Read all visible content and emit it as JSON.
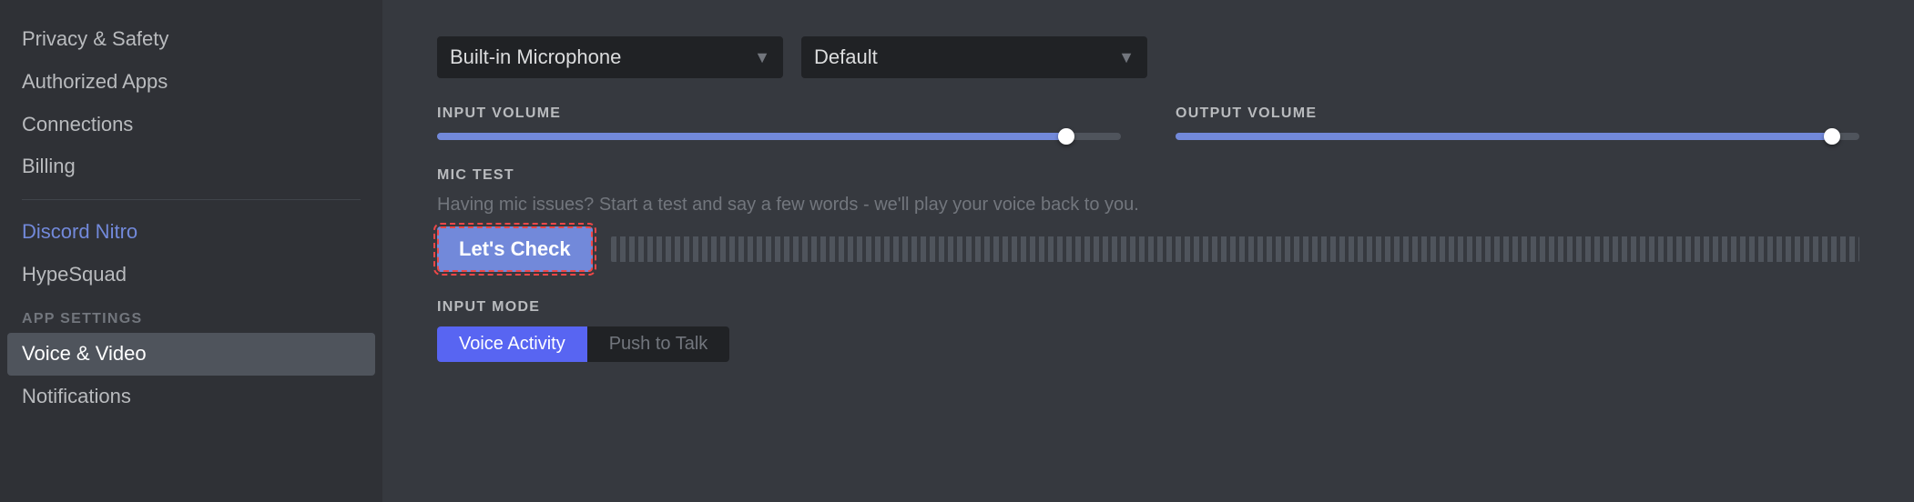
{
  "sidebar": {
    "items": [
      {
        "id": "privacy-safety",
        "label": "Privacy & Safety",
        "active": false,
        "highlighted": false
      },
      {
        "id": "authorized-apps",
        "label": "Authorized Apps",
        "active": false,
        "highlighted": false
      },
      {
        "id": "connections",
        "label": "Connections",
        "active": false,
        "highlighted": false
      },
      {
        "id": "billing",
        "label": "Billing",
        "active": false,
        "highlighted": false
      }
    ],
    "divider": true,
    "highlighted_items": [
      {
        "id": "discord-nitro",
        "label": "Discord Nitro",
        "highlighted": true
      },
      {
        "id": "hypesquad",
        "label": "HypeSquad",
        "highlighted": false
      }
    ],
    "section_header": "APP SETTINGS",
    "app_settings_items": [
      {
        "id": "voice-video",
        "label": "Voice & Video",
        "active": true
      },
      {
        "id": "notifications",
        "label": "Notifications",
        "active": false
      }
    ]
  },
  "main": {
    "input_device": {
      "label": "Built-in Microphone",
      "arrow": "▼"
    },
    "output_device": {
      "label": "Default",
      "arrow": "▼"
    },
    "input_volume": {
      "label": "INPUT VOLUME",
      "fill_percent": 92
    },
    "output_volume": {
      "label": "OUTPUT VOLUME",
      "fill_percent": 96
    },
    "mic_test": {
      "title": "MIC TEST",
      "description": "Having mic issues? Start a test and say a few words - we'll play your voice back to you.",
      "button_label": "Let's Check"
    },
    "input_mode": {
      "title": "INPUT MODE"
    }
  },
  "colors": {
    "accent": "#7289da",
    "active_bg": "#4f545c",
    "sidebar_bg": "#2f3136",
    "main_bg": "#36393f",
    "dark_bg": "#202225",
    "danger": "#f04747",
    "muted": "#72767d",
    "text": "#dcddde",
    "white": "#ffffff",
    "highlighted": "#7289da"
  }
}
